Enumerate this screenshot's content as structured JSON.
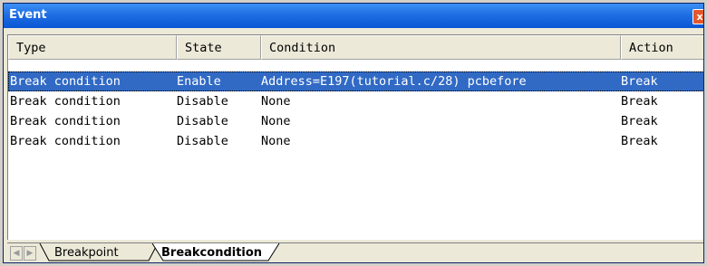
{
  "window": {
    "title": "Event",
    "close_symbol": "x"
  },
  "table": {
    "headers": [
      "Type",
      "State",
      "Condition",
      "Action"
    ],
    "rows": [
      {
        "type": "Break condition",
        "state": "Enable",
        "condition": "Address=E197(tutorial.c/28) pcbefore",
        "action": "Break",
        "selected": true
      },
      {
        "type": "Break condition",
        "state": "Disable",
        "condition": "None",
        "action": "Break",
        "selected": false
      },
      {
        "type": "Break condition",
        "state": "Disable",
        "condition": "None",
        "action": "Break",
        "selected": false
      },
      {
        "type": "Break condition",
        "state": "Disable",
        "condition": "None",
        "action": "Break",
        "selected": false
      }
    ]
  },
  "tabs": {
    "items": [
      {
        "label": "Breakpoint",
        "active": false
      },
      {
        "label": "Breakcondition",
        "active": true
      }
    ],
    "scroll_left_icon": "left-arrow",
    "scroll_right_icon": "right-arrow"
  },
  "colors": {
    "titlebar": "#0a55d4",
    "selection": "#316ac5",
    "close_button": "#e4572e"
  }
}
